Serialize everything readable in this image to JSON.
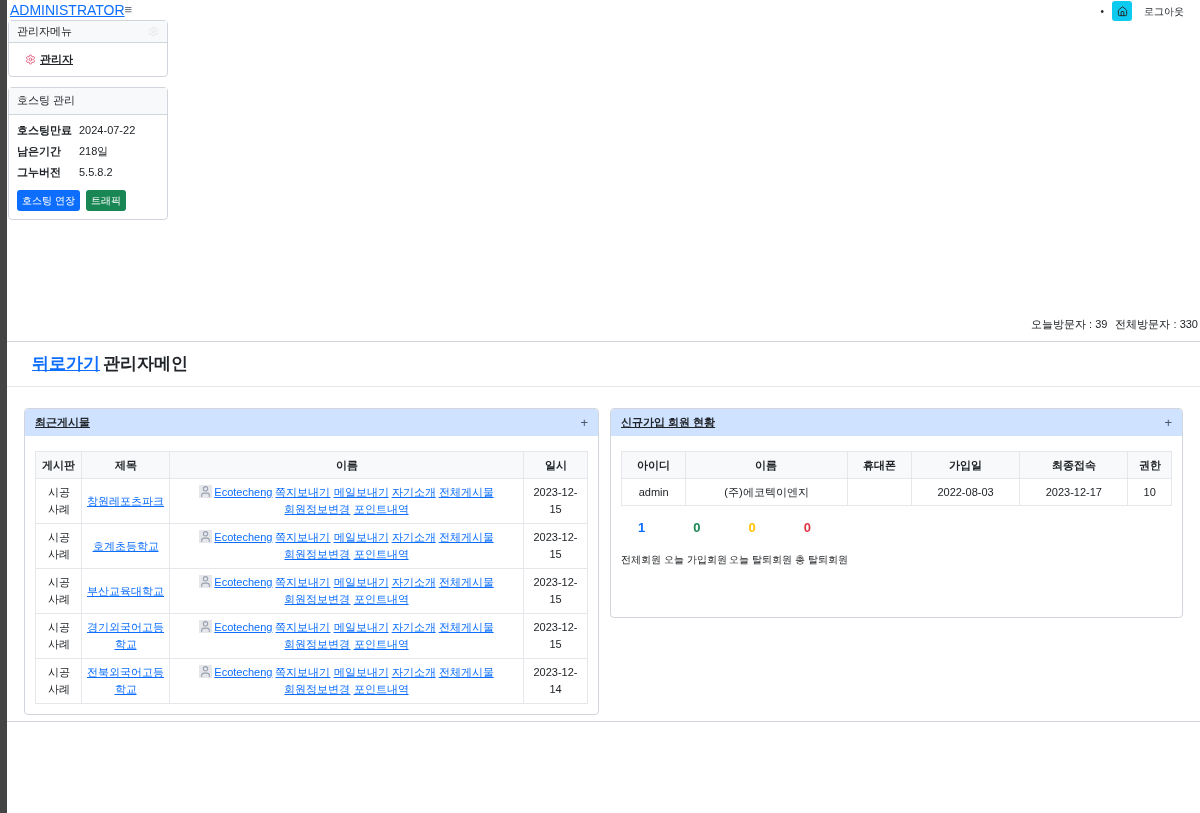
{
  "brand": {
    "title": "ADMINISTRATOR",
    "menu_glyph": "≡"
  },
  "top_bar": {
    "bullet": "•",
    "logout": "로그아웃"
  },
  "admin_menu": {
    "title": "관리자메뉴",
    "items": [
      {
        "label": "관리자"
      }
    ]
  },
  "hosting": {
    "title": "호스팅 관리",
    "rows": [
      {
        "label": "호스팅만료",
        "value": "2024-07-22"
      },
      {
        "label": "남은기간",
        "value": "218일"
      },
      {
        "label": "그누버전",
        "value": "5.5.8.2"
      }
    ],
    "buttons": [
      {
        "label": "호스팅 연장",
        "kind": "primary"
      },
      {
        "label": "트래픽",
        "kind": "success"
      }
    ]
  },
  "visitors": {
    "today": "오늘방문자 : 39",
    "total": "전체방문자 : 330"
  },
  "page_header": {
    "back": "뒤로가기",
    "title": "관리자메인"
  },
  "recent_posts": {
    "title": "최근게시물",
    "add": "+",
    "columns": [
      "게시판",
      "제목",
      "이름",
      "일시"
    ],
    "rows": [
      {
        "board": "시공사례",
        "subject": "창원레포츠파크",
        "links": [
          "Ecotecheng",
          "쪽지보내기",
          "메일보내기",
          "자기소개",
          "전체게시물",
          "회원정보변경",
          "포인트내역"
        ],
        "date": "2023-12-15"
      },
      {
        "board": "시공사례",
        "subject": "호계초등학교",
        "links": [
          "Ecotecheng",
          "쪽지보내기",
          "메일보내기",
          "자기소개",
          "전체게시물",
          "회원정보변경",
          "포인트내역"
        ],
        "date": "2023-12-15"
      },
      {
        "board": "시공사례",
        "subject": "부산교육대학교",
        "links": [
          "Ecotecheng",
          "쪽지보내기",
          "메일보내기",
          "자기소개",
          "전체게시물",
          "회원정보변경",
          "포인트내역"
        ],
        "date": "2023-12-15"
      },
      {
        "board": "시공사례",
        "subject": "경기외국어고등학교",
        "links": [
          "Ecotecheng",
          "쪽지보내기",
          "메일보내기",
          "자기소개",
          "전체게시물",
          "회원정보변경",
          "포인트내역"
        ],
        "date": "2023-12-15"
      },
      {
        "board": "시공사례",
        "subject": "전북외국어고등학교",
        "links": [
          "Ecotecheng",
          "쪽지보내기",
          "메일보내기",
          "자기소개",
          "전체게시물",
          "회원정보변경",
          "포인트내역"
        ],
        "date": "2023-12-14"
      }
    ]
  },
  "new_members": {
    "title": "신규가입 회원 현황",
    "add": "+",
    "columns": [
      "아이디",
      "이름",
      "휴대폰",
      "가입일",
      "최종접속",
      "권한"
    ],
    "rows": [
      [
        "admin",
        "(주)에코텍이엔지",
        "",
        "2022-08-03",
        "2023-12-17",
        "10"
      ]
    ],
    "counts": [
      {
        "value": "1",
        "color": "#0d6efd"
      },
      {
        "value": "0",
        "color": "#198754"
      },
      {
        "value": "0",
        "color": "#ffc107"
      },
      {
        "value": "0",
        "color": "#dc3545"
      }
    ],
    "caption": "전체회원 오늘 가입회원 오늘 탈퇴회원 총 탈퇴회원"
  }
}
